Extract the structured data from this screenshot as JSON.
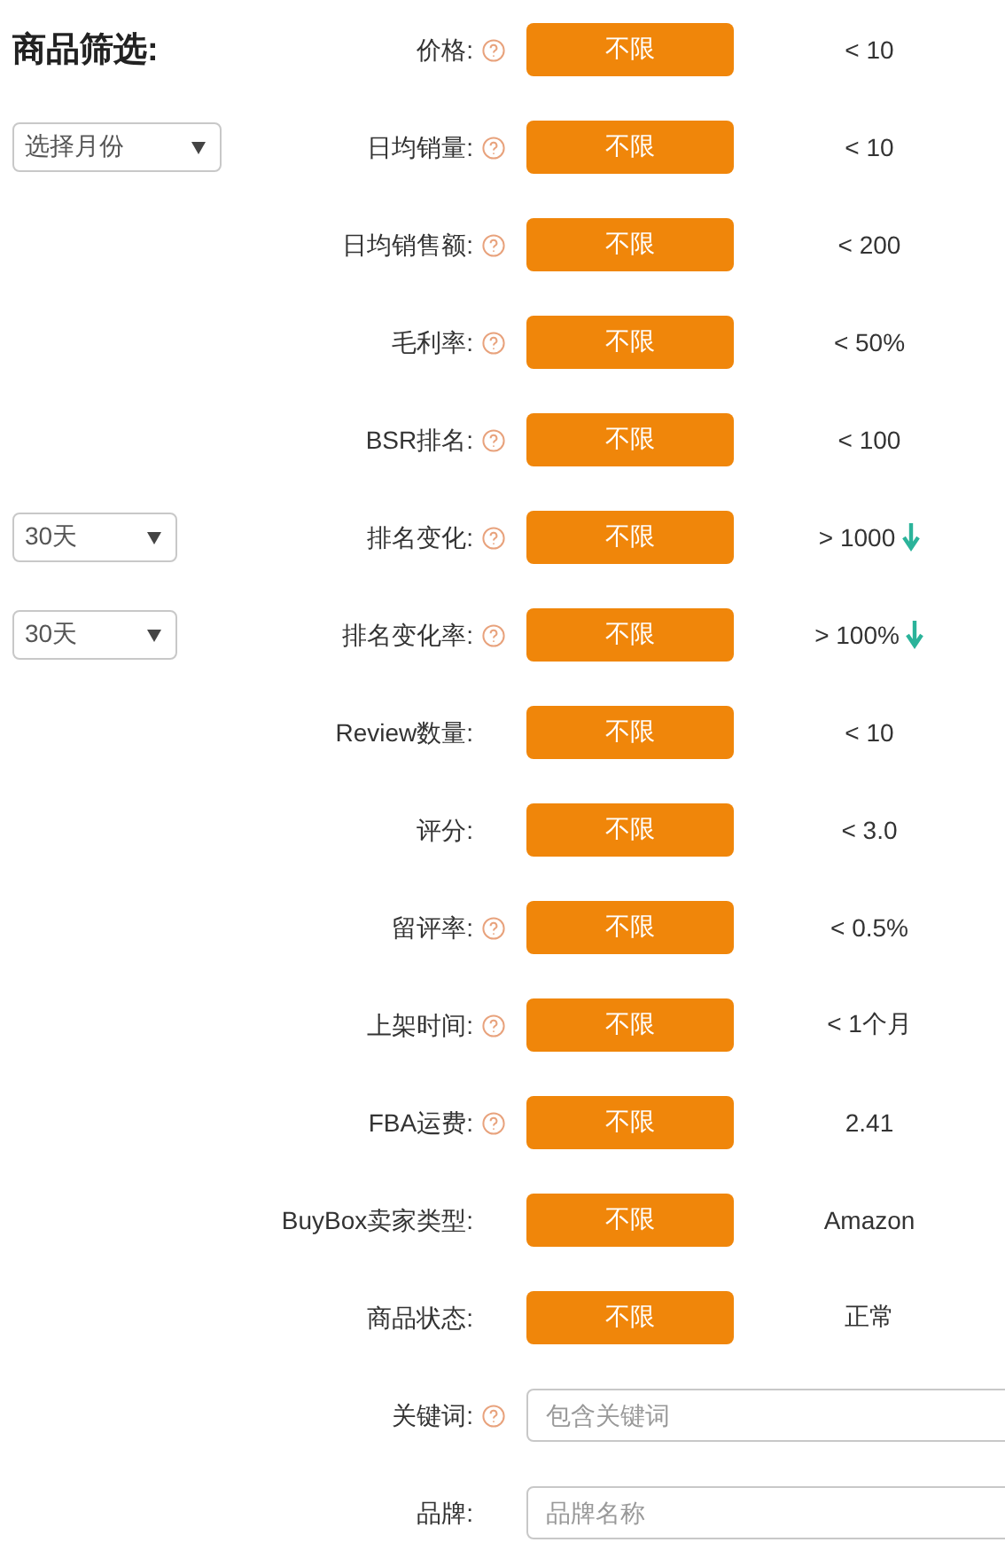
{
  "title": "商品筛选:",
  "filters": [
    {
      "kind": "range",
      "label": "价格:",
      "help": true,
      "button": "不限",
      "value": "< 10"
    },
    {
      "kind": "range",
      "label": "日均销量:",
      "help": true,
      "button": "不限",
      "value": "< 10",
      "select": "选择月份"
    },
    {
      "kind": "range",
      "label": "日均销售额:",
      "help": true,
      "button": "不限",
      "value": "< 200"
    },
    {
      "kind": "range",
      "label": "毛利率:",
      "help": true,
      "button": "不限",
      "value": "< 50%"
    },
    {
      "kind": "range",
      "label": "BSR排名:",
      "help": true,
      "button": "不限",
      "value": "< 100"
    },
    {
      "kind": "range",
      "label": "排名变化:",
      "help": true,
      "button": "不限",
      "value": "> 1000",
      "falling": true,
      "select": "30天"
    },
    {
      "kind": "range",
      "label": "排名变化率:",
      "help": true,
      "button": "不限",
      "value": "> 100%",
      "falling": true,
      "select": "30天"
    },
    {
      "kind": "range",
      "label": "Review数量:",
      "help": false,
      "button": "不限",
      "value": "< 10"
    },
    {
      "kind": "range",
      "label": "评分:",
      "help": false,
      "button": "不限",
      "value": "< 3.0"
    },
    {
      "kind": "range",
      "label": "留评率:",
      "help": true,
      "button": "不限",
      "value": "< 0.5%"
    },
    {
      "kind": "range",
      "label": "上架时间:",
      "help": true,
      "button": "不限",
      "value": "< 1个月"
    },
    {
      "kind": "range",
      "label": "FBA运费:",
      "help": true,
      "button": "不限",
      "value": "2.41"
    },
    {
      "kind": "range",
      "label": "BuyBox卖家类型:",
      "help": false,
      "button": "不限",
      "value": "Amazon"
    },
    {
      "kind": "range",
      "label": "商品状态:",
      "help": false,
      "button": "不限",
      "value": "正常"
    },
    {
      "kind": "input",
      "label": "关键词:",
      "help": true,
      "placeholder": "包含关键词"
    },
    {
      "kind": "input",
      "label": "品牌:",
      "help": false,
      "placeholder": "品牌名称"
    }
  ]
}
